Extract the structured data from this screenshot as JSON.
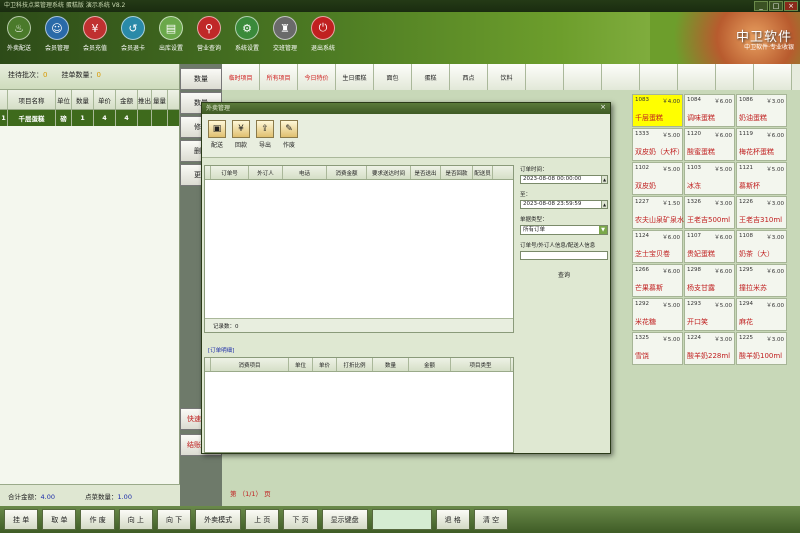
{
  "window": {
    "title": "中卫科技点菜管理系统 蛋糕版 演示系统 V8.2",
    "min": "_",
    "max": "□",
    "close": "×"
  },
  "toolbar": [
    {
      "label": "外卖配送",
      "icon": "scooter-icon",
      "glyph": "♨",
      "color": "#4a7a2a"
    },
    {
      "label": "会员管理",
      "icon": "user-icon",
      "glyph": "☺",
      "color": "#2a6aa8"
    },
    {
      "label": "会员充值",
      "icon": "card-icon",
      "glyph": "¥",
      "color": "#c03030"
    },
    {
      "label": "会员退卡",
      "icon": "card-return-icon",
      "glyph": "↺",
      "color": "#2a8aa8"
    },
    {
      "label": "出库设置",
      "icon": "warehouse-icon",
      "glyph": "▤",
      "color": "#6aa84a"
    },
    {
      "label": "营业查询",
      "icon": "search-icon",
      "glyph": "⚲",
      "color": "#c02828"
    },
    {
      "label": "系统设置",
      "icon": "gear-icon",
      "glyph": "⚙",
      "color": "#3a8a3a"
    },
    {
      "label": "交班管理",
      "icon": "shift-icon",
      "glyph": "♜",
      "color": "#6a6a6a"
    },
    {
      "label": "退出系统",
      "icon": "power-icon",
      "glyph": "⏻",
      "color": "#c02020"
    }
  ],
  "brand": {
    "name": "中卫软件",
    "sub": "中卫软件·专业收银"
  },
  "left_panel": {
    "pending_label": "挂待批次：",
    "pending_value": "0",
    "hang_label": "挂单数量：",
    "hang_value": "0",
    "columns": [
      "",
      "项目名称",
      "单位",
      "数量",
      "单价",
      "金额",
      "推出",
      "量量"
    ],
    "rows": [
      {
        "idx": "1",
        "name": "千层蛋糕",
        "unit": "磅",
        "qty": "1",
        "price": "4",
        "amount": "4"
      }
    ],
    "total_label": "合计金额：",
    "total_value": "4.00",
    "count_label": "点菜数量：",
    "count_value": "1.00"
  },
  "mid_buttons": [
    "数量",
    "数量",
    "修改",
    "删除",
    "更多",
    "快速结账",
    "结账[F9]"
  ],
  "categories": [
    "临时项目",
    "所有项目",
    "今日特价",
    "生日蛋糕",
    "面包",
    "蛋糕",
    "西点",
    "饮料",
    "",
    "",
    "",
    "",
    "",
    "",
    ""
  ],
  "page_info": "第 （1/1） 页",
  "products": [
    [
      {
        "code": "1083",
        "price": "￥4.00",
        "name": "千层蛋糕",
        "hl": true
      },
      {
        "code": "1084",
        "price": "￥6.00",
        "name": "调味蛋糕"
      },
      {
        "code": "1086",
        "price": "￥3.00",
        "name": "奶油蛋糕"
      }
    ],
    [
      {
        "code": "1333",
        "price": "￥5.00",
        "name": "双皮奶（大杯）"
      },
      {
        "code": "1120",
        "price": "￥6.00",
        "name": "酸蜜蛋糕"
      },
      {
        "code": "1119",
        "price": "￥6.00",
        "name": "梅花杯蛋糕"
      }
    ],
    [
      {
        "code": "1102",
        "price": "￥5.00",
        "name": "双皮奶"
      },
      {
        "code": "1103",
        "price": "￥5.00",
        "name": "冰冻"
      },
      {
        "code": "1121",
        "price": "￥5.00",
        "name": "慕斯杯"
      }
    ],
    [
      {
        "code": "1227",
        "price": "￥1.50",
        "name": "农夫山泉矿泉水"
      },
      {
        "code": "1326",
        "price": "￥3.00",
        "name": "王老吉500ml"
      },
      {
        "code": "1226",
        "price": "￥3.00",
        "name": "王老吉310ml"
      }
    ],
    [
      {
        "code": "1124",
        "price": "￥6.00",
        "name": "芝士宝贝卷"
      },
      {
        "code": "1107",
        "price": "￥6.00",
        "name": "贵妃蛋糕"
      },
      {
        "code": "1108",
        "price": "￥3.00",
        "name": "奶茶（大）"
      }
    ],
    [
      {
        "code": "1266",
        "price": "￥6.00",
        "name": "芒果慕斯"
      },
      {
        "code": "1298",
        "price": "￥6.00",
        "name": "杨支甘露"
      },
      {
        "code": "1295",
        "price": "￥6.00",
        "name": "撞拉米苏"
      }
    ],
    [
      {
        "code": "1292",
        "price": "￥5.00",
        "name": "米花糖"
      },
      {
        "code": "1293",
        "price": "￥5.00",
        "name": "开口笑"
      },
      {
        "code": "1294",
        "price": "￥6.00",
        "name": "麻花"
      }
    ],
    [
      {
        "code": "1325",
        "price": "￥5.00",
        "name": "雪饶"
      },
      {
        "code": "1224",
        "price": "￥3.00",
        "name": "酸羊奶228ml"
      },
      {
        "code": "1225",
        "price": "￥3.00",
        "name": "酸羊奶100ml"
      }
    ]
  ],
  "bottom_buttons": [
    "挂 单",
    "取 单",
    "作 废",
    "向 上",
    "向 下",
    "外卖模式",
    "上 页",
    "下 页",
    "显示键盘",
    "",
    "退 格",
    "清 空"
  ],
  "dialog": {
    "title": "外卖管理",
    "tools": [
      {
        "label": "配送",
        "icon": "delivery-icon",
        "glyph": "▣"
      },
      {
        "label": "回款",
        "icon": "coin-icon",
        "glyph": "¥"
      },
      {
        "label": "导出",
        "icon": "export-icon",
        "glyph": "⇪"
      },
      {
        "label": "作废",
        "icon": "void-icon",
        "glyph": "✎"
      }
    ],
    "grid1_columns": [
      "",
      "订单号",
      "外订人",
      "电话",
      "消费金额",
      "要求送达时间",
      "是否送出",
      "是否回款",
      "配送员"
    ],
    "record_label": "记录数：0",
    "filters": {
      "from_label": "订单时间：",
      "from_date": "2023-08-08",
      "from_time": "00:00:00",
      "to_label": "至：",
      "to_date": "2023-08-08",
      "to_time": "23:59:59",
      "type_label": "单据类型：",
      "type_value": "所有订单",
      "keyword_label": "订单号/外订人信息/配送人信息",
      "query_button": "查询"
    },
    "section2_label": "[订单明细]",
    "grid2_columns": [
      "",
      "消费项目",
      "单位",
      "单价",
      "打折比例",
      "数量",
      "金额",
      "项目类型"
    ]
  }
}
